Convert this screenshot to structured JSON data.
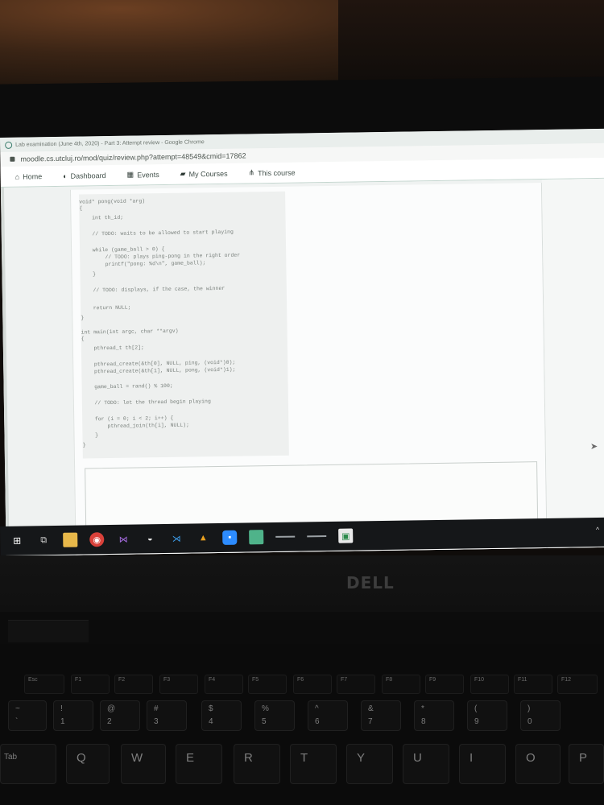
{
  "browser": {
    "window_title": "Lab examination (June 4th, 2020) - Part 3: Attempt review - Google Chrome",
    "url": "moodle.cs.utcluj.ro/mod/quiz/review.php?attempt=48549&cmid=17862"
  },
  "navbar": {
    "items": [
      {
        "icon": "home-icon",
        "label": "Home"
      },
      {
        "icon": "dashboard-icon",
        "label": "Dashboard"
      },
      {
        "icon": "calendar-icon",
        "label": "Events"
      },
      {
        "icon": "graduation-cap-icon",
        "label": "My Courses"
      },
      {
        "icon": "sitemap-icon",
        "label": "This course"
      }
    ]
  },
  "code": {
    "lines": [
      "void* pong(void *arg)",
      "{",
      "    int th_id;",
      "    // TODO: waits to be allowed to start playing",
      "    while (game_ball > 0) {",
      "        // TODO: plays ping-pong in the right order",
      "        printf(\"pong: %d\\n\", game_ball);",
      "    }",
      "    // TODO: displays, if the case, the winner",
      "    return NULL;",
      "}",
      "int main(int argc, char **argv)",
      "{",
      "    pthread_t th[2];",
      "    pthread_create(&th[0], NULL, ping, (void*)0);",
      "    pthread_create(&th[1], NULL, pong, (void*)1);",
      "    game_ball = rand() % 100;",
      "    // TODO: let the thread begin playing",
      "    for (i = 0; i < 2; i++) {",
      "        pthread_join(th[i], NULL);",
      "    }",
      "}"
    ]
  },
  "laptop": {
    "brand": "DELL",
    "function_keys": [
      "Esc",
      "F1",
      "F2",
      "F3",
      "F4",
      "F5",
      "F6",
      "F7",
      "F8",
      "F9",
      "F10",
      "F11",
      "F12"
    ],
    "number_row": [
      {
        "top": "~",
        "bottom": "`"
      },
      {
        "top": "!",
        "bottom": "1"
      },
      {
        "top": "@",
        "bottom": "2"
      },
      {
        "top": "#",
        "bottom": "3"
      },
      {
        "top": "$",
        "bottom": "4"
      },
      {
        "top": "%",
        "bottom": "5"
      },
      {
        "top": "^",
        "bottom": "6"
      },
      {
        "top": "&",
        "bottom": "7"
      },
      {
        "top": "*",
        "bottom": "8"
      },
      {
        "top": "(",
        "bottom": "9"
      },
      {
        "top": ")",
        "bottom": "0"
      }
    ],
    "letter_row": [
      "Tab",
      "Q",
      "W",
      "E",
      "R",
      "T",
      "Y",
      "U",
      "I",
      "O",
      "P"
    ]
  },
  "taskbar": {
    "icons": [
      "windows-start-icon",
      "task-view-icon",
      "file-explorer-icon",
      "chrome-icon",
      "visual-studio-icon",
      "edge-icon",
      "vscode-icon",
      "matlab-icon",
      "zoom-icon",
      "notepad-icon",
      "app-icon"
    ]
  },
  "colors": {
    "accent": "#3a7d6d",
    "page_bg": "#eff2f1",
    "code_text": "#7b827e"
  }
}
